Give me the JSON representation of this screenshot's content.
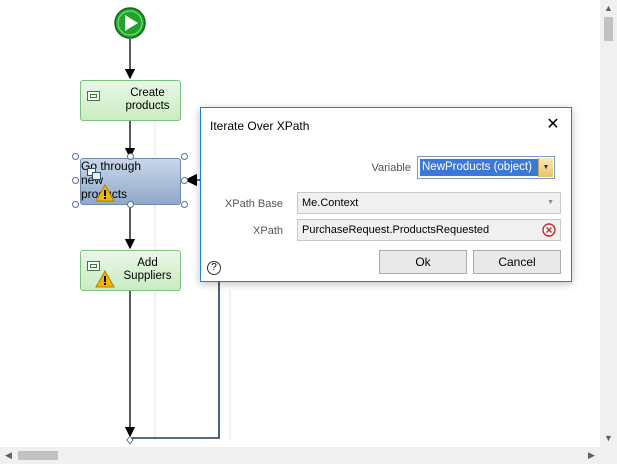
{
  "flow": {
    "activities": [
      {
        "label_line1": "Create",
        "label_line2": "products",
        "warning": false
      },
      {
        "label_line1": "Add",
        "label_line2": "Suppliers",
        "warning": true
      }
    ],
    "loop": {
      "label_line1": "Go through",
      "label_line2": "new",
      "label_line3": "products",
      "warning": true
    }
  },
  "dialog": {
    "title": "Iterate Over XPath",
    "close_glyph": "✕",
    "variable_label": "Variable",
    "variable_value": "NewProducts (object)",
    "xpath_base_label": "XPath Base",
    "xpath_base_value": "Me.Context",
    "xpath_label": "XPath",
    "xpath_value": "PurchaseRequest.ProductsRequested",
    "ok_label": "Ok",
    "cancel_label": "Cancel",
    "help_glyph": "?"
  },
  "scrollbars": {
    "up": "▲",
    "down": "▼",
    "left": "◀",
    "right": "▶"
  },
  "colors": {
    "start_event": "#1fa32a",
    "dialog_border": "#2b79d6",
    "selection": "#3c78d8",
    "error": "#c62828",
    "warning": "#f2b600"
  }
}
